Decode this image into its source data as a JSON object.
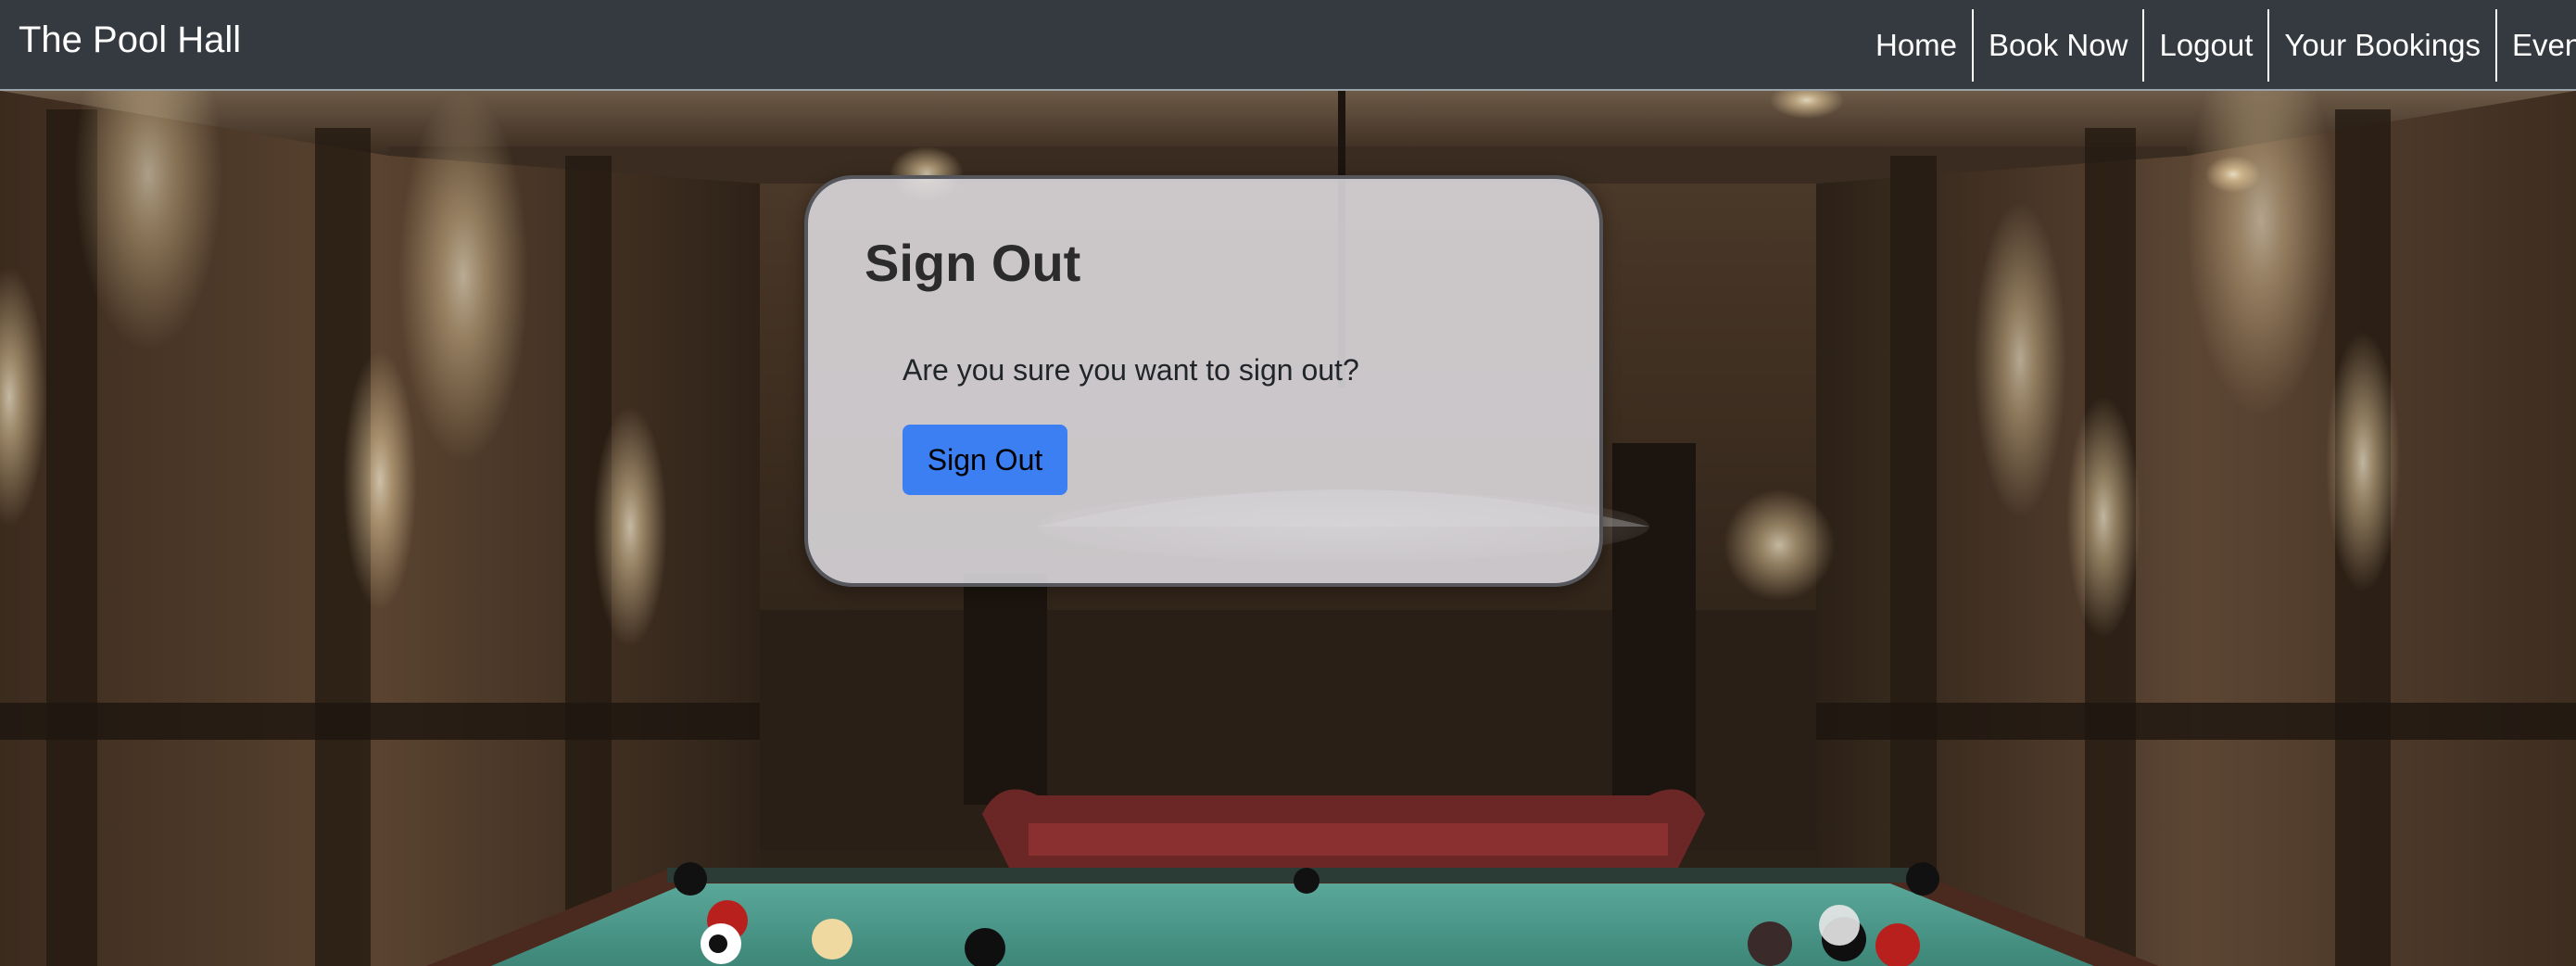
{
  "navbar": {
    "brand": "The Pool Hall",
    "links": [
      {
        "label": "Home"
      },
      {
        "label": "Book Now"
      },
      {
        "label": "Logout"
      },
      {
        "label": "Your Bookings"
      },
      {
        "label": "Event"
      }
    ]
  },
  "dialog": {
    "title": "Sign Out",
    "message": "Are you sure you want to sign out?",
    "button_label": "Sign Out"
  },
  "colors": {
    "navbar_bg": "#343a40",
    "button_bg": "#3b7ff2",
    "felt": "#4a9a8c"
  }
}
